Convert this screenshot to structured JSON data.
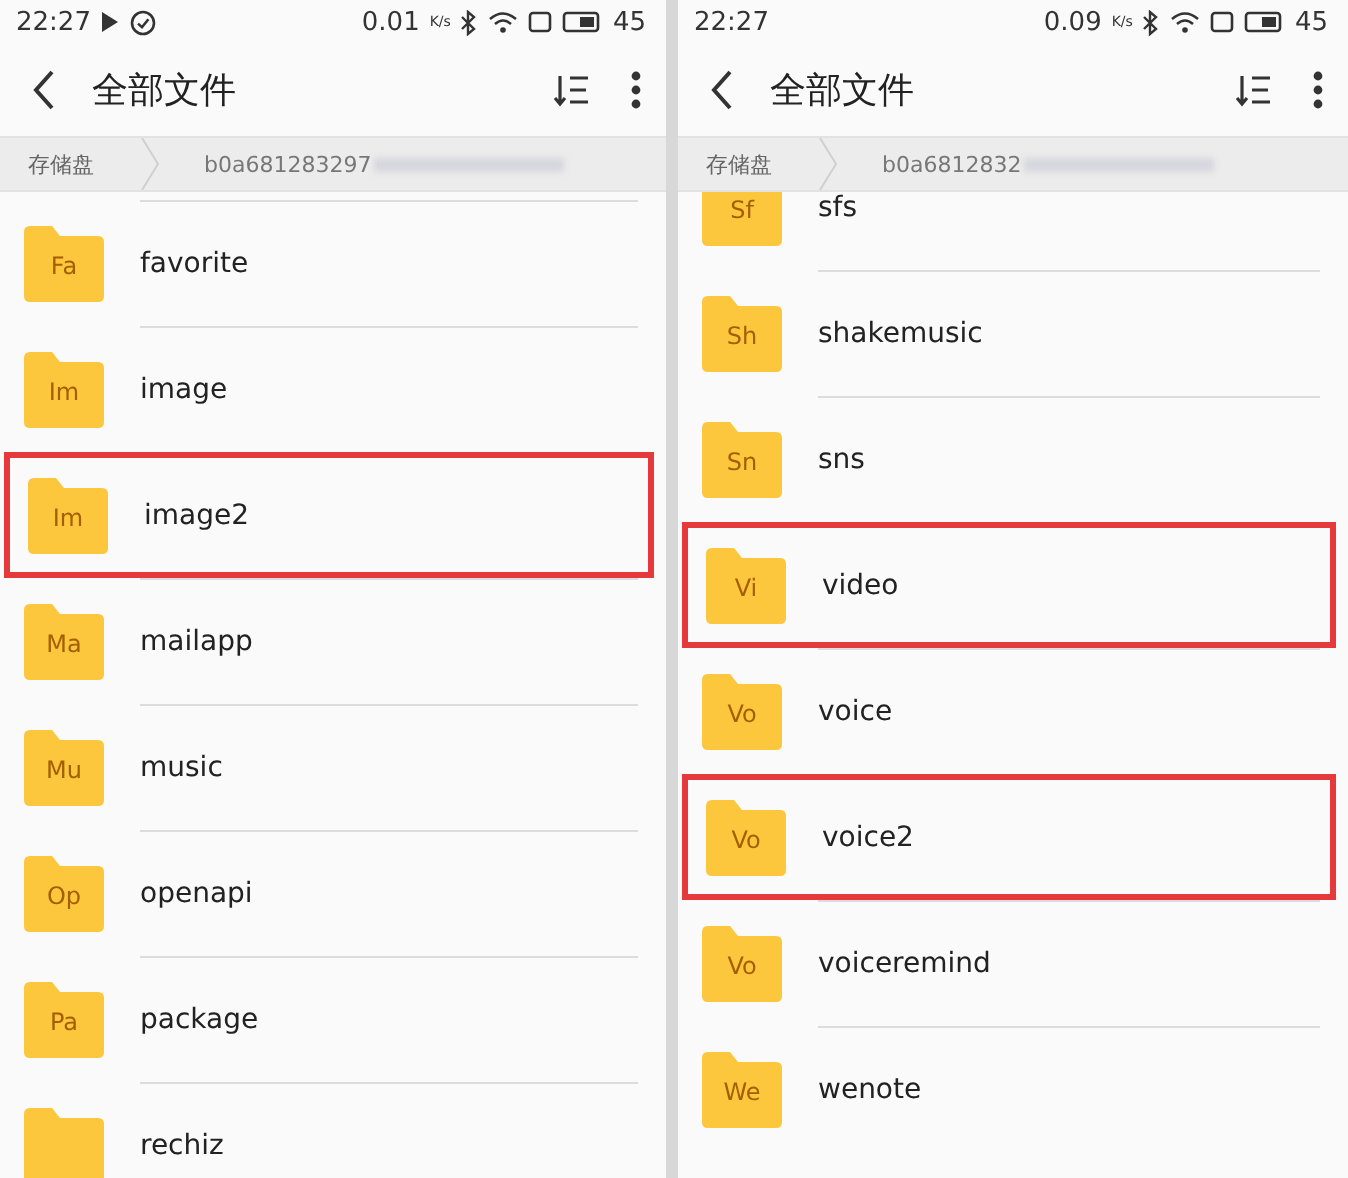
{
  "panels": [
    {
      "status_bar": {
        "time": "22:27",
        "media_playing": true,
        "task_done": true,
        "net_speed": "0.01",
        "speed_unit": "K/s",
        "battery": "45"
      },
      "toolbar": {
        "title": "全部文件"
      },
      "breadcrumb": {
        "root": "存储盘",
        "path": "b0a681283297",
        "path_redacted": true
      },
      "folders": [
        {
          "badge": "Fa",
          "name": "favorite",
          "highlighted": false
        },
        {
          "badge": "Im",
          "name": "image",
          "highlighted": false
        },
        {
          "badge": "Im",
          "name": "image2",
          "highlighted": true
        },
        {
          "badge": "Ma",
          "name": "mailapp",
          "highlighted": false
        },
        {
          "badge": "Mu",
          "name": "music",
          "highlighted": false
        },
        {
          "badge": "Op",
          "name": "openapi",
          "highlighted": false
        },
        {
          "badge": "Pa",
          "name": "package",
          "highlighted": false
        },
        {
          "name": "rechiz",
          "highlighted": false
        }
      ]
    },
    {
      "status_bar": {
        "time": "22:27",
        "net_speed": "0.09",
        "speed_unit": "K/s",
        "battery": "45"
      },
      "toolbar": {
        "title": "全部文件"
      },
      "breadcrumb": {
        "root": "存储盘",
        "path": "b0a6812832",
        "path_redacted": true
      },
      "folders": [
        {
          "badge": "Sf",
          "name": "sfs",
          "highlighted": false
        },
        {
          "badge": "Sh",
          "name": "shakemusic",
          "highlighted": false
        },
        {
          "badge": "Sn",
          "name": "sns",
          "highlighted": false
        },
        {
          "badge": "Vi",
          "name": "video",
          "highlighted": true
        },
        {
          "badge": "Vo",
          "name": "voice",
          "highlighted": false
        },
        {
          "badge": "Vo",
          "name": "voice2",
          "highlighted": true
        },
        {
          "badge": "Vo",
          "name": "voiceremind",
          "highlighted": false
        },
        {
          "badge": "We",
          "name": "wenote",
          "highlighted": false
        }
      ]
    }
  ]
}
